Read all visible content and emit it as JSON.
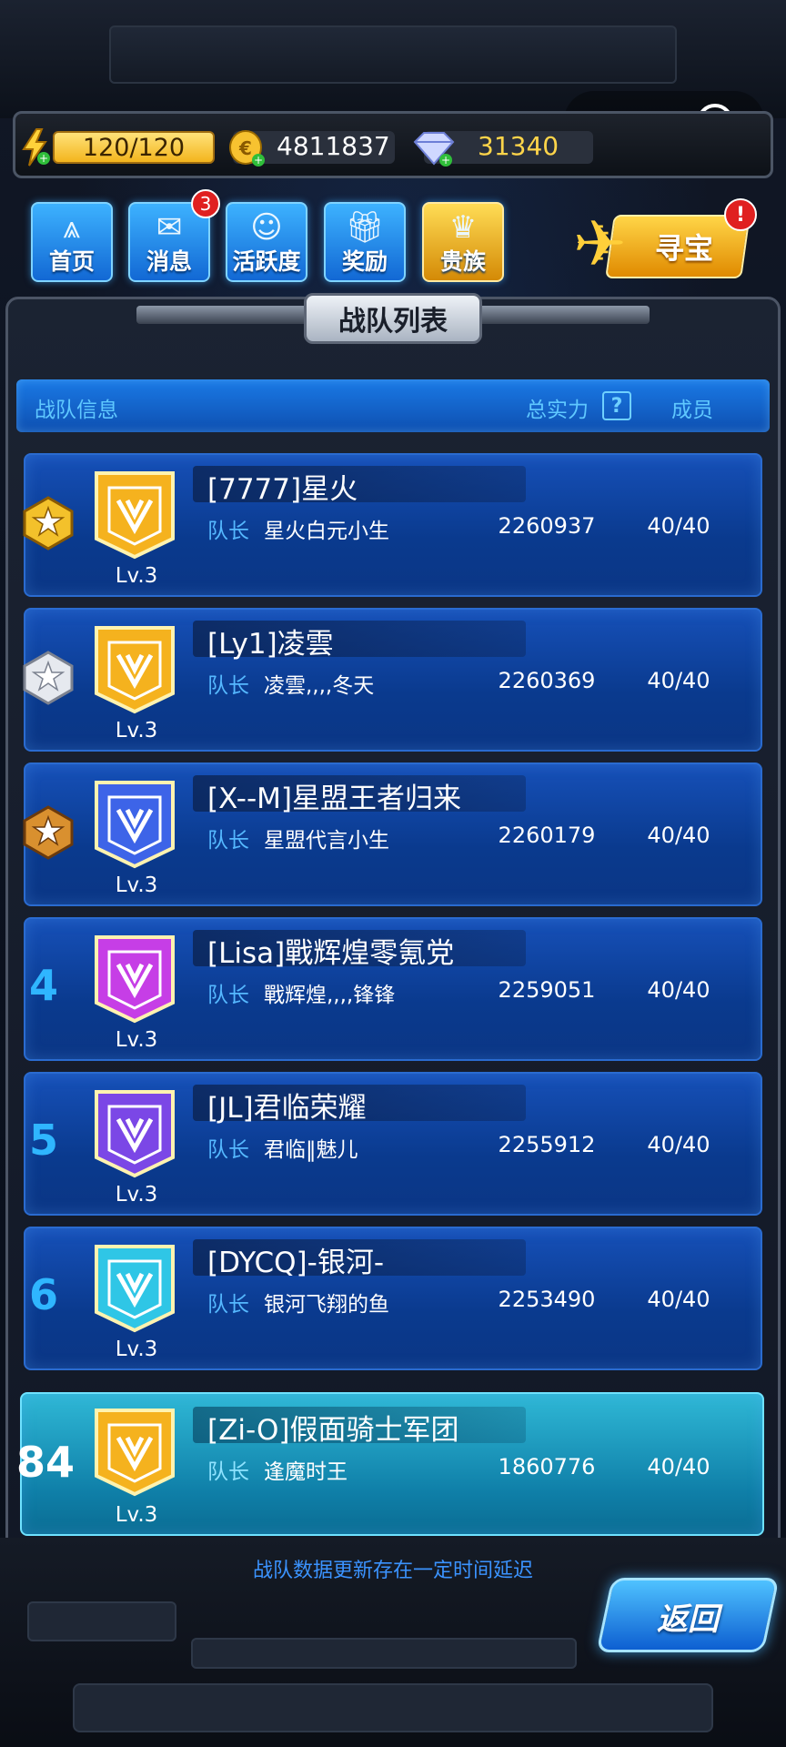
{
  "resources": {
    "energy": "120/120",
    "coins": "4811837",
    "gems": "31340"
  },
  "nav": [
    {
      "label": "首页",
      "icon": "home-icon"
    },
    {
      "label": "消息",
      "icon": "message-icon",
      "badge": "3"
    },
    {
      "label": "活跃度",
      "icon": "smile-icon"
    },
    {
      "label": "奖励",
      "icon": "gift-icon"
    },
    {
      "label": "贵族",
      "icon": "noble-icon"
    }
  ],
  "treasure": {
    "label": "寻宝",
    "badge": "!"
  },
  "panel": {
    "title": "战队列表",
    "header": {
      "info": "战队信息",
      "power": "总实力",
      "help": "?",
      "members": "成员"
    }
  },
  "teams": [
    {
      "rank": "1",
      "name": "[7777]星火",
      "captain_label": "队长",
      "captain": "星火白元小生",
      "power": "2260937",
      "members": "40/40",
      "level": "Lv.3",
      "medal": "gold",
      "emblem_color": "#f5b21e"
    },
    {
      "rank": "2",
      "name": "[Ly1]凌雲",
      "captain_label": "队长",
      "captain": "凌雲,,,,冬天",
      "power": "2260369",
      "members": "40/40",
      "level": "Lv.3",
      "medal": "silver",
      "emblem_color": "#f5b21e"
    },
    {
      "rank": "3",
      "name": "[X--M]星盟王者归来",
      "captain_label": "队长",
      "captain": "星盟代言小生",
      "power": "2260179",
      "members": "40/40",
      "level": "Lv.3",
      "medal": "bronze",
      "emblem_color": "#3d64e8"
    },
    {
      "rank": "4",
      "name": "[Lisa]戰辉煌零氪党",
      "captain_label": "队长",
      "captain": "戰辉煌,,,,锋锋",
      "power": "2259051",
      "members": "40/40",
      "level": "Lv.3",
      "emblem_color": "#c63ee6"
    },
    {
      "rank": "5",
      "name": "[JL]君临荣耀",
      "captain_label": "队长",
      "captain": "君临‖魅儿",
      "power": "2255912",
      "members": "40/40",
      "level": "Lv.3",
      "emblem_color": "#7b47e6"
    },
    {
      "rank": "6",
      "name": "[DYCQ]-银河-",
      "captain_label": "队长",
      "captain": "银河飞翔的鱼",
      "power": "2253490",
      "members": "40/40",
      "level": "Lv.3",
      "emblem_color": "#2fc6e6"
    }
  ],
  "my_team": {
    "rank": "84",
    "name": "[Zi-O]假面骑士军团",
    "captain_label": "队长",
    "captain": "逢魔时王",
    "power": "1860776",
    "members": "40/40",
    "level": "Lv.3",
    "emblem_color": "#f5b21e"
  },
  "footer_note": "战队数据更新存在一定时间延迟",
  "back_label": "返回",
  "colors": {
    "accent": "#2fb6ff",
    "row": "#0b3c8f",
    "highlight": "#1aa0c8",
    "gold": "#f5b21e"
  }
}
